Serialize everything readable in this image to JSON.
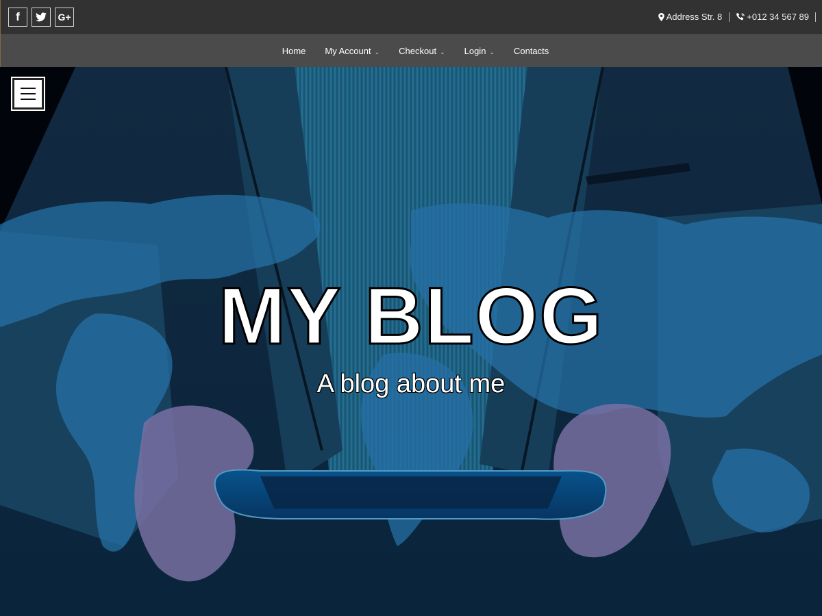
{
  "topbar": {
    "socials": [
      {
        "icon": "facebook-icon",
        "glyph": "f"
      },
      {
        "icon": "twitter-icon",
        "glyph": ""
      },
      {
        "icon": "google-plus-icon",
        "glyph": "G+"
      }
    ],
    "address": "Address Str. 8",
    "phone": "+012 34 567 89"
  },
  "nav": {
    "items": [
      {
        "label": "Home",
        "dropdown": false
      },
      {
        "label": "My Account",
        "dropdown": true
      },
      {
        "label": "Checkout",
        "dropdown": true
      },
      {
        "label": "Login",
        "dropdown": true
      },
      {
        "label": "Contacts",
        "dropdown": false
      }
    ],
    "caret": "⌄"
  },
  "hero": {
    "title": "MY BLOG",
    "subtitle": "A blog about me",
    "menu_icon": "hamburger-icon"
  },
  "colors": {
    "topbar_bg": "#323232",
    "navbar_bg": "#4b4b4b",
    "hero_tint": "#1a6fb0"
  }
}
